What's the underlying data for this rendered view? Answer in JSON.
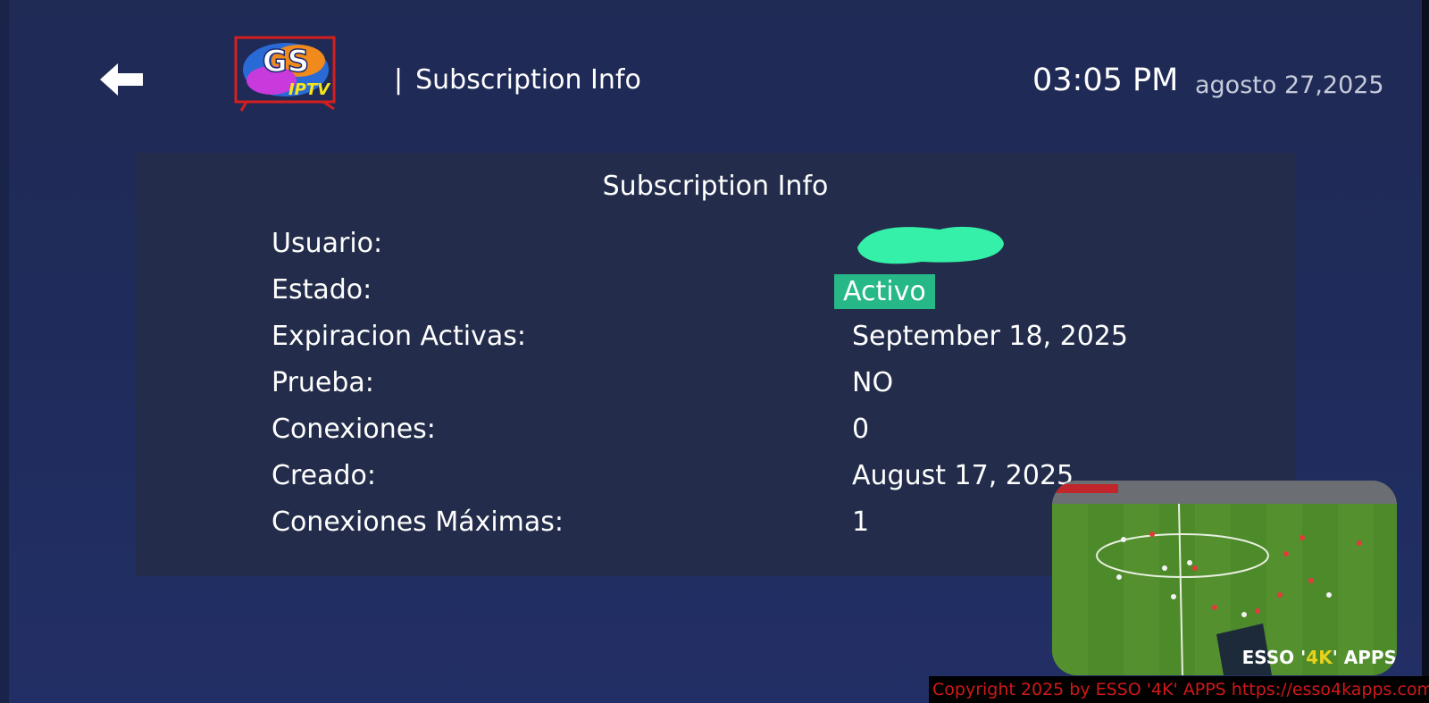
{
  "header": {
    "back_icon": "arrow-left-icon",
    "logo": {
      "line1": "GS",
      "line2": "IPTV"
    },
    "separator": "|",
    "title": "Subscription Info",
    "time": "03:05 PM",
    "date": "agosto 27,2025"
  },
  "panel": {
    "title": "Subscription Info",
    "rows": [
      {
        "label": "Usuario:",
        "value": ""
      },
      {
        "label": "Estado:",
        "value": "Activo"
      },
      {
        "label": "Expiracion Activas:",
        "value": "September 18, 2025"
      },
      {
        "label": "Prueba:",
        "value": "NO"
      },
      {
        "label": "Conexiones:",
        "value": "0"
      },
      {
        "label": "Creado:",
        "value": "August 17, 2025"
      },
      {
        "label": "Conexiones Máximas:",
        "value": "1"
      }
    ]
  },
  "video": {
    "label_pre": "ESSO '",
    "label_hl": "4K",
    "label_post": "' APPS"
  },
  "footer": {
    "copyright": "Copyright 2025  by ESSO '4K' APPS https://esso4kapps.com/"
  },
  "colors": {
    "background": "#1f2a55",
    "panel": "#232d4b",
    "status_active": "#26b886",
    "copyright_text": "#d01818"
  }
}
